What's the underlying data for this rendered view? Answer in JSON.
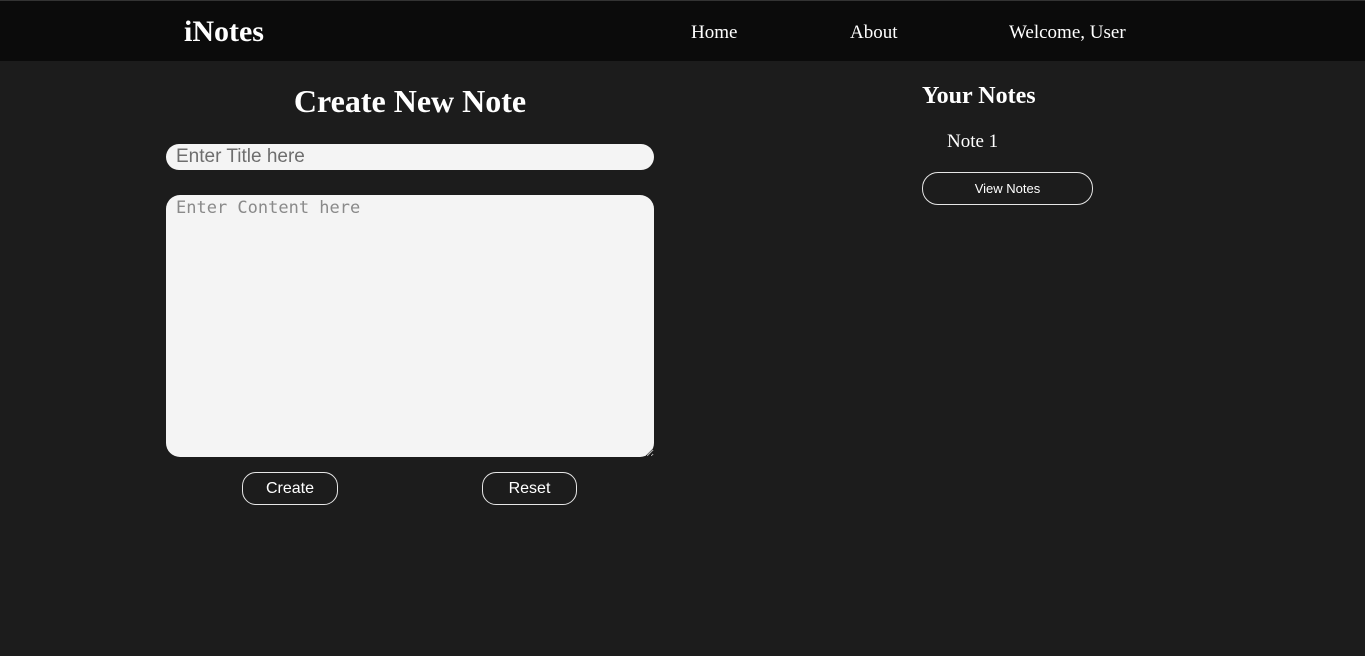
{
  "navbar": {
    "brand": "iNotes",
    "links": {
      "home": "Home",
      "about": "About"
    },
    "welcome": "Welcome, User"
  },
  "create_note": {
    "heading": "Create New Note",
    "title_placeholder": "Enter Title here",
    "title_value": "",
    "content_placeholder": "Enter Content here",
    "content_value": "",
    "create_label": "Create",
    "reset_label": "Reset"
  },
  "your_notes": {
    "heading": "Your Notes",
    "items": [
      "Note 1"
    ],
    "view_label": "View Notes"
  },
  "colors": {
    "background": "#1c1c1c",
    "navbar": "#0b0b0b",
    "input_background": "#f4f4f4",
    "text": "#ffffff"
  }
}
